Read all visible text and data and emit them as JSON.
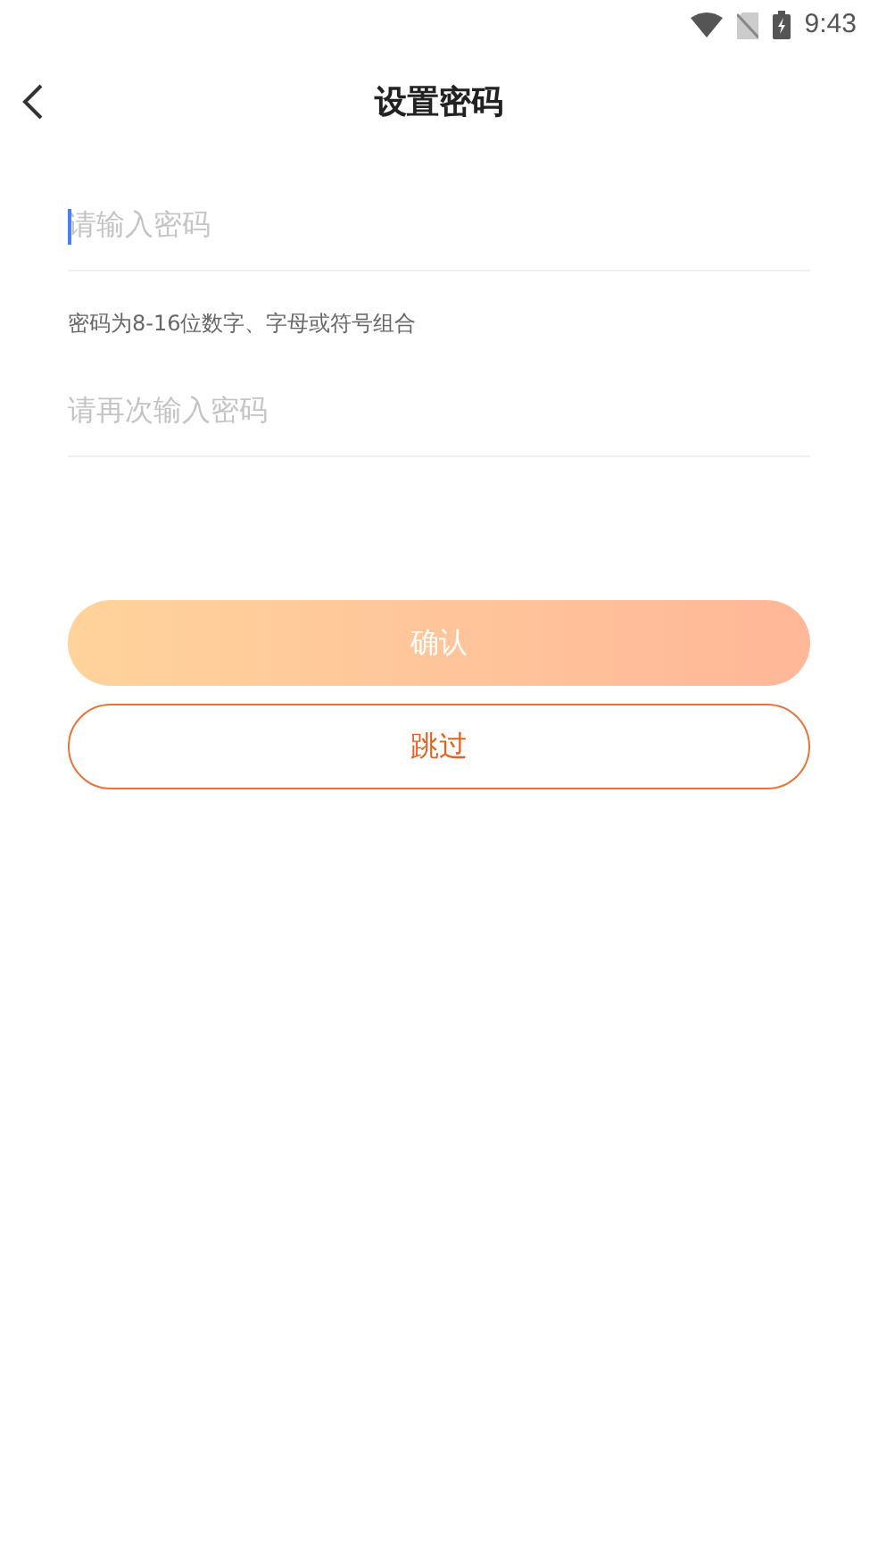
{
  "status_bar": {
    "time": "9:43"
  },
  "header": {
    "title": "设置密码"
  },
  "fields": [
    {
      "placeholder": "请输入密码",
      "focused": true
    },
    {
      "placeholder": "请再次输入密码",
      "focused": false
    }
  ],
  "hint": "密码为8-16位数字、字母或符号组合",
  "buttons": [
    {
      "kind": "primary",
      "label": "确认",
      "disabled": true
    },
    {
      "kind": "outline",
      "label": "跳过",
      "disabled": false
    }
  ]
}
